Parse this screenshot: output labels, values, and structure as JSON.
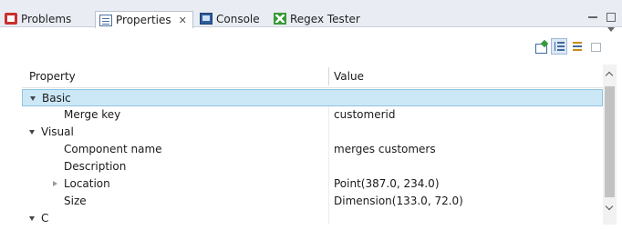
{
  "tabs": [
    {
      "label": "Problems",
      "icon": "problems-icon"
    },
    {
      "label": "Properties",
      "icon": "properties-icon",
      "active": true,
      "close": "✕"
    },
    {
      "label": "Console",
      "icon": "console-icon"
    },
    {
      "label": "Regex Tester",
      "icon": "regex-tester-icon"
    }
  ],
  "toolbar": {
    "buttons": [
      "pin-to-selection-icon",
      "show-categories-icon",
      "show-advanced-properties-icon",
      "restore-default-icon"
    ],
    "view_menu": "view-menu-icon"
  },
  "table": {
    "headers": {
      "property": "Property",
      "value": "Value"
    },
    "rows": [
      {
        "property": "Basic",
        "value": "",
        "level": 0,
        "expanded": true,
        "selected": true
      },
      {
        "property": "Merge key",
        "value": "customerid",
        "level": 1
      },
      {
        "property": "Visual",
        "value": "",
        "level": 0,
        "expanded": true
      },
      {
        "property": "Component name",
        "value": "merges customers",
        "level": 1
      },
      {
        "property": "Description",
        "value": "",
        "level": 1
      },
      {
        "property": "Location",
        "value": "Point(387.0, 234.0)",
        "level": 1,
        "expandable": true
      },
      {
        "property": "Size",
        "value": "Dimension(133.0, 72.0)",
        "level": 1
      },
      {
        "property": "C",
        "value": "",
        "level": 0,
        "partial": true
      }
    ]
  },
  "colors": {
    "tab_bar": "#e9edf3",
    "selection": "#cce8f7",
    "selection_border": "#8fc3e0"
  }
}
